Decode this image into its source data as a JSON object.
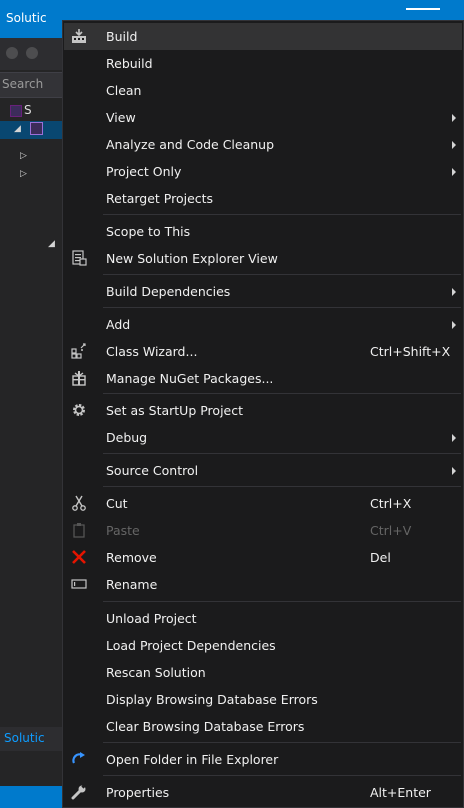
{
  "solution_explorer": {
    "title": "Solutic",
    "search_text": "Search",
    "tree_root_label": "S",
    "footer_tab": "Solutic"
  },
  "menu": {
    "items": [
      {
        "label": "Build",
        "icon": "build-icon",
        "submenu": false,
        "shortcut": "",
        "disabled": false,
        "hover": true
      },
      {
        "label": "Rebuild",
        "icon": "",
        "submenu": false,
        "shortcut": "",
        "disabled": false
      },
      {
        "label": "Clean",
        "icon": "",
        "submenu": false,
        "shortcut": "",
        "disabled": false
      },
      {
        "label": "View",
        "icon": "",
        "submenu": true,
        "shortcut": "",
        "disabled": false
      },
      {
        "label": "Analyze and Code Cleanup",
        "icon": "",
        "submenu": true,
        "shortcut": "",
        "disabled": false
      },
      {
        "label": "Project Only",
        "icon": "",
        "submenu": true,
        "shortcut": "",
        "disabled": false
      },
      {
        "label": "Retarget Projects",
        "icon": "",
        "submenu": false,
        "shortcut": "",
        "disabled": false
      },
      {
        "label": "Scope to This",
        "icon": "",
        "submenu": false,
        "shortcut": "",
        "disabled": false
      },
      {
        "label": "New Solution Explorer View",
        "icon": "new-explorer-view-icon",
        "submenu": false,
        "shortcut": "",
        "disabled": false
      },
      {
        "label": "Build Dependencies",
        "icon": "",
        "submenu": true,
        "shortcut": "",
        "disabled": false
      },
      {
        "label": "Add",
        "icon": "",
        "submenu": true,
        "shortcut": "",
        "disabled": false
      },
      {
        "label": "Class Wizard...",
        "icon": "class-wizard-icon",
        "submenu": false,
        "shortcut": "Ctrl+Shift+X",
        "disabled": false
      },
      {
        "label": "Manage NuGet Packages...",
        "icon": "nuget-icon",
        "submenu": false,
        "shortcut": "",
        "disabled": false
      },
      {
        "label": "Set as StartUp Project",
        "icon": "gear-icon",
        "submenu": false,
        "shortcut": "",
        "disabled": false
      },
      {
        "label": "Debug",
        "icon": "",
        "submenu": true,
        "shortcut": "",
        "disabled": false
      },
      {
        "label": "Source Control",
        "icon": "",
        "submenu": true,
        "shortcut": "",
        "disabled": false
      },
      {
        "label": "Cut",
        "icon": "scissors-icon",
        "submenu": false,
        "shortcut": "Ctrl+X",
        "disabled": false
      },
      {
        "label": "Paste",
        "icon": "paste-icon",
        "submenu": false,
        "shortcut": "Ctrl+V",
        "disabled": true
      },
      {
        "label": "Remove",
        "icon": "remove-icon",
        "submenu": false,
        "shortcut": "Del",
        "disabled": false
      },
      {
        "label": "Rename",
        "icon": "rename-icon",
        "submenu": false,
        "shortcut": "",
        "disabled": false
      },
      {
        "label": "Unload Project",
        "icon": "",
        "submenu": false,
        "shortcut": "",
        "disabled": false
      },
      {
        "label": "Load Project Dependencies",
        "icon": "",
        "submenu": false,
        "shortcut": "",
        "disabled": false
      },
      {
        "label": "Rescan Solution",
        "icon": "",
        "submenu": false,
        "shortcut": "",
        "disabled": false
      },
      {
        "label": "Display Browsing Database Errors",
        "icon": "",
        "submenu": false,
        "shortcut": "",
        "disabled": false
      },
      {
        "label": "Clear Browsing Database Errors",
        "icon": "",
        "submenu": false,
        "shortcut": "",
        "disabled": false
      },
      {
        "label": "Open Folder in File Explorer",
        "icon": "open-folder-icon",
        "submenu": false,
        "shortcut": "",
        "disabled": false
      },
      {
        "label": "Properties",
        "icon": "wrench-icon",
        "submenu": false,
        "shortcut": "Alt+Enter",
        "disabled": false
      }
    ]
  },
  "colors": {
    "accent": "#007acc",
    "menu_background": "#1b1b1c",
    "menu_text": "#f1f1f1",
    "disabled_text": "#656565",
    "remove_icon": "#e51400"
  }
}
